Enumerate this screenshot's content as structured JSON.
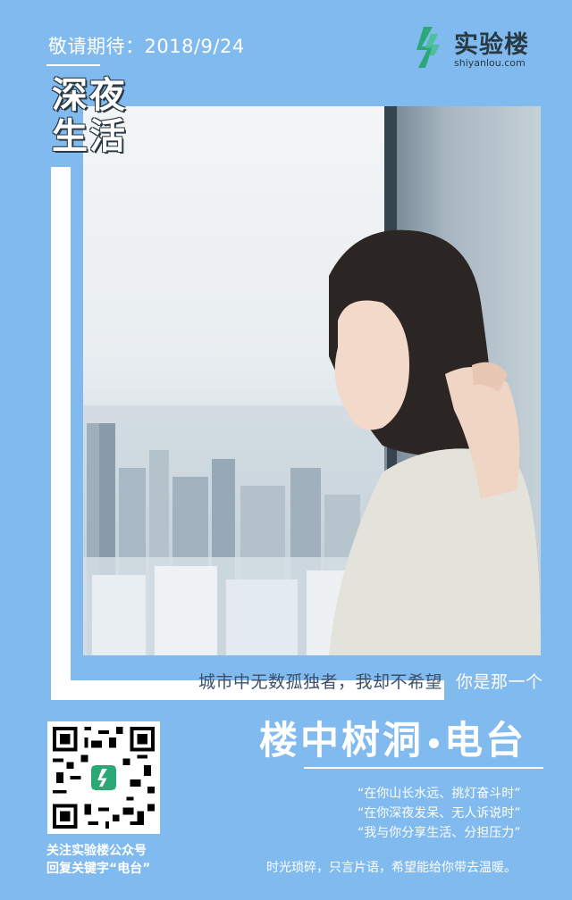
{
  "header": {
    "date_text": "敬请期待：2018/9/24"
  },
  "logo": {
    "cn": "实验楼",
    "en": "shiyanlou.com",
    "brand_color": "#2aa876"
  },
  "title": {
    "line1": "深夜",
    "line2": "生活"
  },
  "photo": {
    "icon": "woman-by-window-photo"
  },
  "caption": {
    "part1": "城市中无数孤独者，我却不希望",
    "part2": "你是那一个"
  },
  "qr": {
    "follow_line1": "关注实验楼公众号",
    "follow_line2": "回复关键字“电台”",
    "center_label": "实验楼"
  },
  "radio": {
    "title_part1": "楼中树洞",
    "title_part2": "电台",
    "quotes": [
      "“在你山长水远、挑灯奋斗时”",
      "“在你深夜发呆、无人诉说时”",
      "“我与你分享生活、分担压力”"
    ],
    "tagline": "时光琐碎，只言片语，希望能给你带去温暖。"
  },
  "colors": {
    "background": "#80baee",
    "dark_text": "#2a3a44",
    "caption_text": "#3d4f6a"
  }
}
